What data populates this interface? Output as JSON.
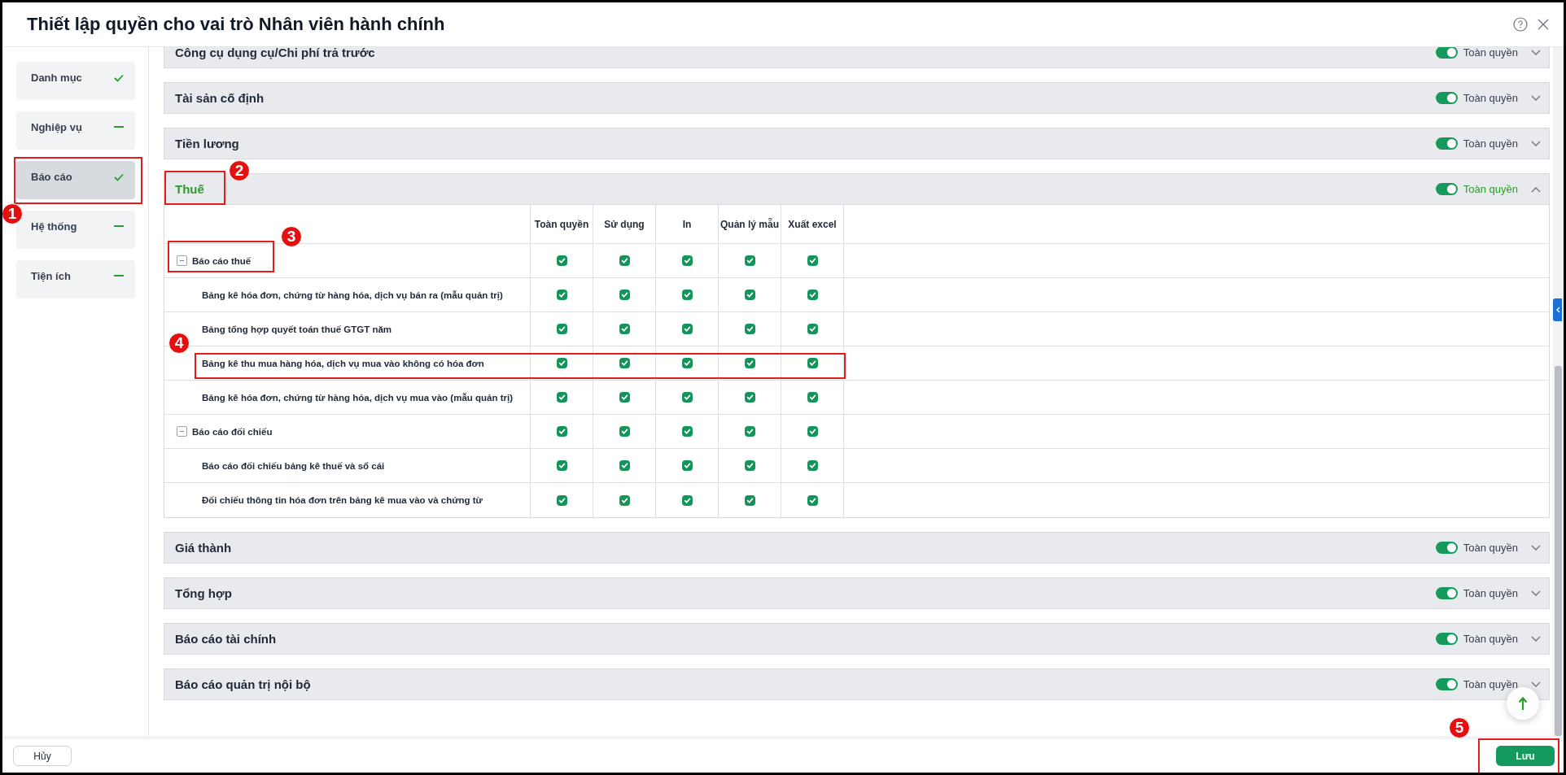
{
  "dialog": {
    "title": "Thiết lập quyền cho vai trò Nhân viên hành chính"
  },
  "sidebar": {
    "items": [
      {
        "label": "Danh mục",
        "selected": false,
        "complete": true
      },
      {
        "label": "Nghiệp vụ",
        "selected": false,
        "complete": false
      },
      {
        "label": "Báo cáo",
        "selected": true,
        "complete": true
      },
      {
        "label": "Hệ thống",
        "selected": false,
        "complete": false
      },
      {
        "label": "Tiện ích",
        "selected": false,
        "complete": false
      }
    ]
  },
  "sections": [
    {
      "title": "Công cụ dụng cụ/Chi phí trả trước",
      "expanded": false,
      "toggle_on": true,
      "toggle_label": "Toàn quyền"
    },
    {
      "title": "Tài sản cố định",
      "expanded": false,
      "toggle_on": true,
      "toggle_label": "Toàn quyền"
    },
    {
      "title": "Tiền lương",
      "expanded": false,
      "toggle_on": true,
      "toggle_label": "Toàn quyền"
    },
    {
      "title": "Thuế",
      "expanded": true,
      "toggle_on": true,
      "toggle_label": "Toàn quyền",
      "table": {
        "columns": [
          "Toàn quyền",
          "Sử dụng",
          "In",
          "Quản lý mẫu",
          "Xuất excel"
        ],
        "rows": [
          {
            "label": "Báo cáo thuế",
            "expanded": true,
            "checks": [
              true,
              true,
              true,
              true,
              true
            ],
            "children": [
              {
                "label": "Bảng kê hóa đơn, chứng từ hàng hóa, dịch vụ bán ra (mẫu quản trị)",
                "checks": [
                  true,
                  true,
                  true,
                  true,
                  true
                ]
              },
              {
                "label": "Bảng tổng hợp quyết toán thuế GTGT năm",
                "checks": [
                  true,
                  true,
                  true,
                  true,
                  true
                ]
              },
              {
                "label": "Bảng kê thu mua hàng hóa, dịch vụ mua vào không có hóa đơn",
                "checks": [
                  true,
                  true,
                  true,
                  true,
                  true
                ]
              },
              {
                "label": "Bảng kê hóa đơn, chứng từ hàng hóa, dịch vụ mua vào (mẫu quản trị)",
                "checks": [
                  true,
                  true,
                  true,
                  true,
                  true
                ]
              }
            ]
          },
          {
            "label": "Báo cáo đối chiếu",
            "expanded": true,
            "checks": [
              true,
              true,
              true,
              true,
              true
            ],
            "children": [
              {
                "label": "Báo cáo đối chiếu bảng kê thuế và sổ cái",
                "checks": [
                  true,
                  true,
                  true,
                  true,
                  true
                ]
              },
              {
                "label": "Đối chiếu thông tin hóa đơn trên bảng kê mua vào và chứng từ",
                "checks": [
                  true,
                  true,
                  true,
                  true,
                  true
                ]
              }
            ]
          }
        ]
      }
    },
    {
      "title": "Giá thành",
      "expanded": false,
      "toggle_on": true,
      "toggle_label": "Toàn quyền"
    },
    {
      "title": "Tổng hợp",
      "expanded": false,
      "toggle_on": true,
      "toggle_label": "Toàn quyền"
    },
    {
      "title": "Báo cáo tài chính",
      "expanded": false,
      "toggle_on": true,
      "toggle_label": "Toàn quyền"
    },
    {
      "title": "Báo cáo quản trị nội bộ",
      "expanded": false,
      "toggle_on": true,
      "toggle_label": "Toàn quyền"
    }
  ],
  "footer": {
    "cancel": "Hủy",
    "save": "Lưu"
  },
  "annotations": [
    {
      "number": "1"
    },
    {
      "number": "2"
    },
    {
      "number": "3"
    },
    {
      "number": "4"
    },
    {
      "number": "5"
    }
  ]
}
